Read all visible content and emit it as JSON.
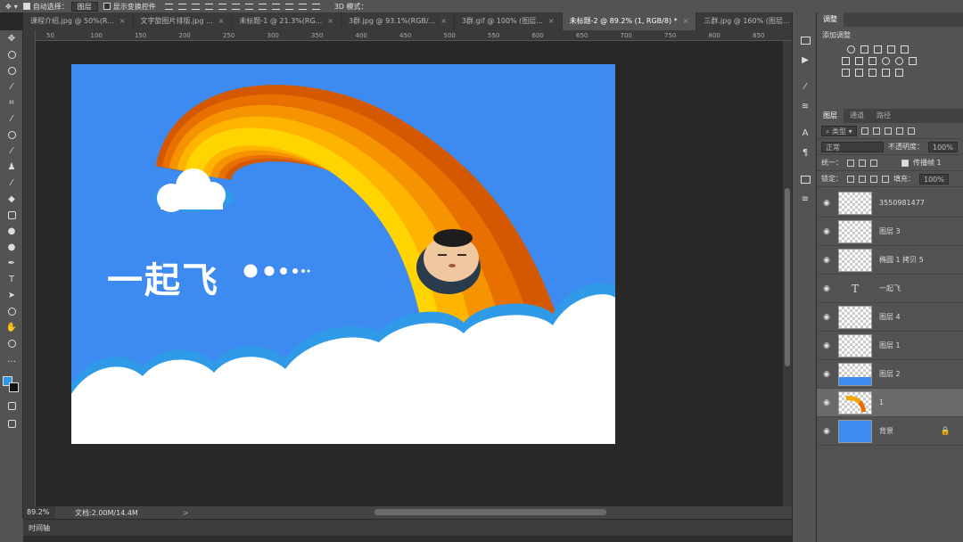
{
  "options_bar": {
    "auto_select_label": "自动选择：",
    "auto_select_target": "图层",
    "show_transform_label": "显示变换控件",
    "mode_3d_label": "3D 模式："
  },
  "tabs": [
    {
      "label": "课程介绍.jpg @ 50%(R...",
      "active": false
    },
    {
      "label": "文字旋图片排版.jpg ...",
      "active": false
    },
    {
      "label": "未标题-1 @ 21.3%(RG...",
      "active": false
    },
    {
      "label": "3群.jpg @ 93.1%(RGB/...",
      "active": false
    },
    {
      "label": "3群.gif @ 100% (图层...",
      "active": false
    },
    {
      "label": "未标题-2 @ 89.2% (1, RGB/8) *",
      "active": true
    },
    {
      "label": "三群.jpg @ 160% (图层...",
      "active": false
    }
  ],
  "ruler_ticks": [
    "50",
    "100",
    "150",
    "200",
    "250",
    "300",
    "350",
    "400",
    "450",
    "500",
    "550",
    "600",
    "650",
    "700",
    "750",
    "800",
    "850"
  ],
  "canvas": {
    "title_text": "一起飞",
    "colors": {
      "sky": "#3d8bf0",
      "cloud_outline": "#2f9be8",
      "cloud": "#ffffff",
      "rainbow": [
        "#ffd400",
        "#ffb400",
        "#f59400",
        "#e87000",
        "#d45800"
      ]
    }
  },
  "status": {
    "zoom": "89.2%",
    "doc_info": "文档:2.00M/14.4M",
    "arrow": ">"
  },
  "timeline": {
    "label": "时间轴"
  },
  "adjust_panel": {
    "tab": "调整",
    "subtitle": "添加调整"
  },
  "layers_panel": {
    "tabs": [
      "图层",
      "通道",
      "路径"
    ],
    "filter_kind": "类型",
    "blend_mode": "正常",
    "opacity_label": "不透明度：",
    "opacity_value": "100%",
    "unify_label": "统一：",
    "propagate_label": "传播帧 1",
    "lock_label": "锁定：",
    "fill_label": "填充：",
    "fill_value": "100%",
    "layers": [
      {
        "name": "3550981477",
        "kind": "smart",
        "selected": false
      },
      {
        "name": "图层 3",
        "kind": "pixel",
        "selected": false
      },
      {
        "name": "椭圆 1 拷贝 5",
        "kind": "shape",
        "selected": false
      },
      {
        "name": "一起飞",
        "kind": "text",
        "selected": false
      },
      {
        "name": "图层 4",
        "kind": "pixel",
        "selected": false
      },
      {
        "name": "图层 1",
        "kind": "pixel",
        "selected": false
      },
      {
        "name": "图层 2",
        "kind": "cloud",
        "selected": false
      },
      {
        "name": "1",
        "kind": "rainbow",
        "selected": true
      },
      {
        "name": "背景",
        "kind": "background",
        "selected": false
      }
    ]
  }
}
